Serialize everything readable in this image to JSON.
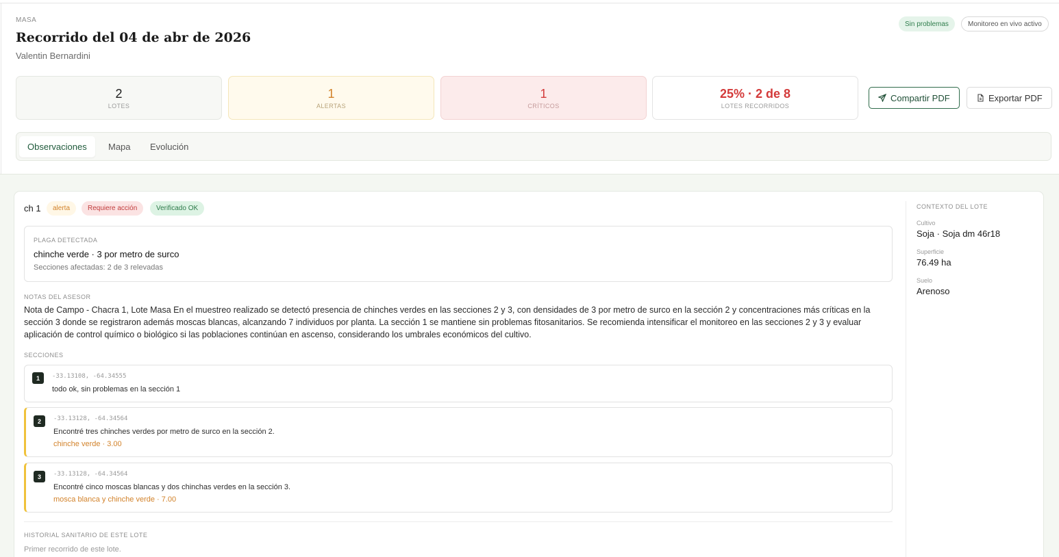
{
  "header": {
    "org": "MASA",
    "title": "Recorrido del 04 de abr de 2026",
    "author": "Valentin Bernardini",
    "status_ok": "Sin problemas",
    "status_live": "Monitoreo en vivo activo"
  },
  "stats": {
    "lotes": {
      "value": "2",
      "label": "LOTES"
    },
    "alertas": {
      "value": "1",
      "label": "ALERTAS"
    },
    "criticos": {
      "value": "1",
      "label": "CRÍTICOS"
    },
    "recorridos": {
      "value": "25% · 2 de 8",
      "label": "LOTES RECORRIDOS"
    }
  },
  "actions": {
    "share": "Compartir PDF",
    "export": "Exportar PDF"
  },
  "tabs": [
    "Observaciones",
    "Mapa",
    "Evolución"
  ],
  "lote": {
    "name": "ch 1",
    "badge_alerta": "alerta",
    "badge_accion": "Requiere acción",
    "badge_verificado": "Verificado OK",
    "plaga": {
      "label": "PLAGA DETECTADA",
      "main": "chinche verde · 3 por metro de surco",
      "sub": "Secciones afectadas: 2 de 3 relevadas"
    },
    "notas_label": "NOTAS DEL ASESOR",
    "notas": "Nota de Campo - Chacra 1, Lote Masa En el muestreo realizado se detectó presencia de chinches verdes en las secciones 2 y 3, con densidades de 3 por metro de surco en la sección 2 y concentraciones más críticas en la sección 3 donde se registraron además moscas blancas, alcanzando 7 individuos por planta. La sección 1 se mantiene sin problemas fitosanitarios. Se recomienda intensificar el monitoreo en las secciones 2 y 3 y evaluar aplicación de control químico o biológico si las poblaciones continúan en ascenso, considerando los umbrales económicos del cultivo.",
    "secciones_label": "SECCIONES",
    "secciones": [
      {
        "num": "1",
        "coords": "-33.13108, -64.34555",
        "text": "todo ok, sin problemas en la sección 1",
        "tag": ""
      },
      {
        "num": "2",
        "coords": "-33.13128, -64.34564",
        "text": "Encontré tres chinches verdes por metro de surco en la sección 2.",
        "tag": "chinche verde · 3.00"
      },
      {
        "num": "3",
        "coords": "-33.13128, -64.34564",
        "text": "Encontré cinco moscas blancas y dos chinchas verdes en la sección 3.",
        "tag": "mosca blanca y chinche verde · 7.00"
      }
    ],
    "historial_label": "HISTORIAL SANITARIO DE ESTE LOTE",
    "historial_text": "Primer recorrido de este lote."
  },
  "contexto": {
    "label": "CONTEXTO DEL LOTE",
    "cultivo_k": "Cultivo",
    "cultivo_v": "Soja · Soja dm 46r18",
    "superficie_k": "Superficie",
    "superficie_v": "76.49 ha",
    "suelo_k": "Suelo",
    "suelo_v": "Arenoso"
  },
  "colors": {
    "brand": "#1f5a3b",
    "alert": "#d2822a",
    "critical": "#d33a3a",
    "ok": "#2d7a4a",
    "warn_border": "#f0c23a"
  }
}
